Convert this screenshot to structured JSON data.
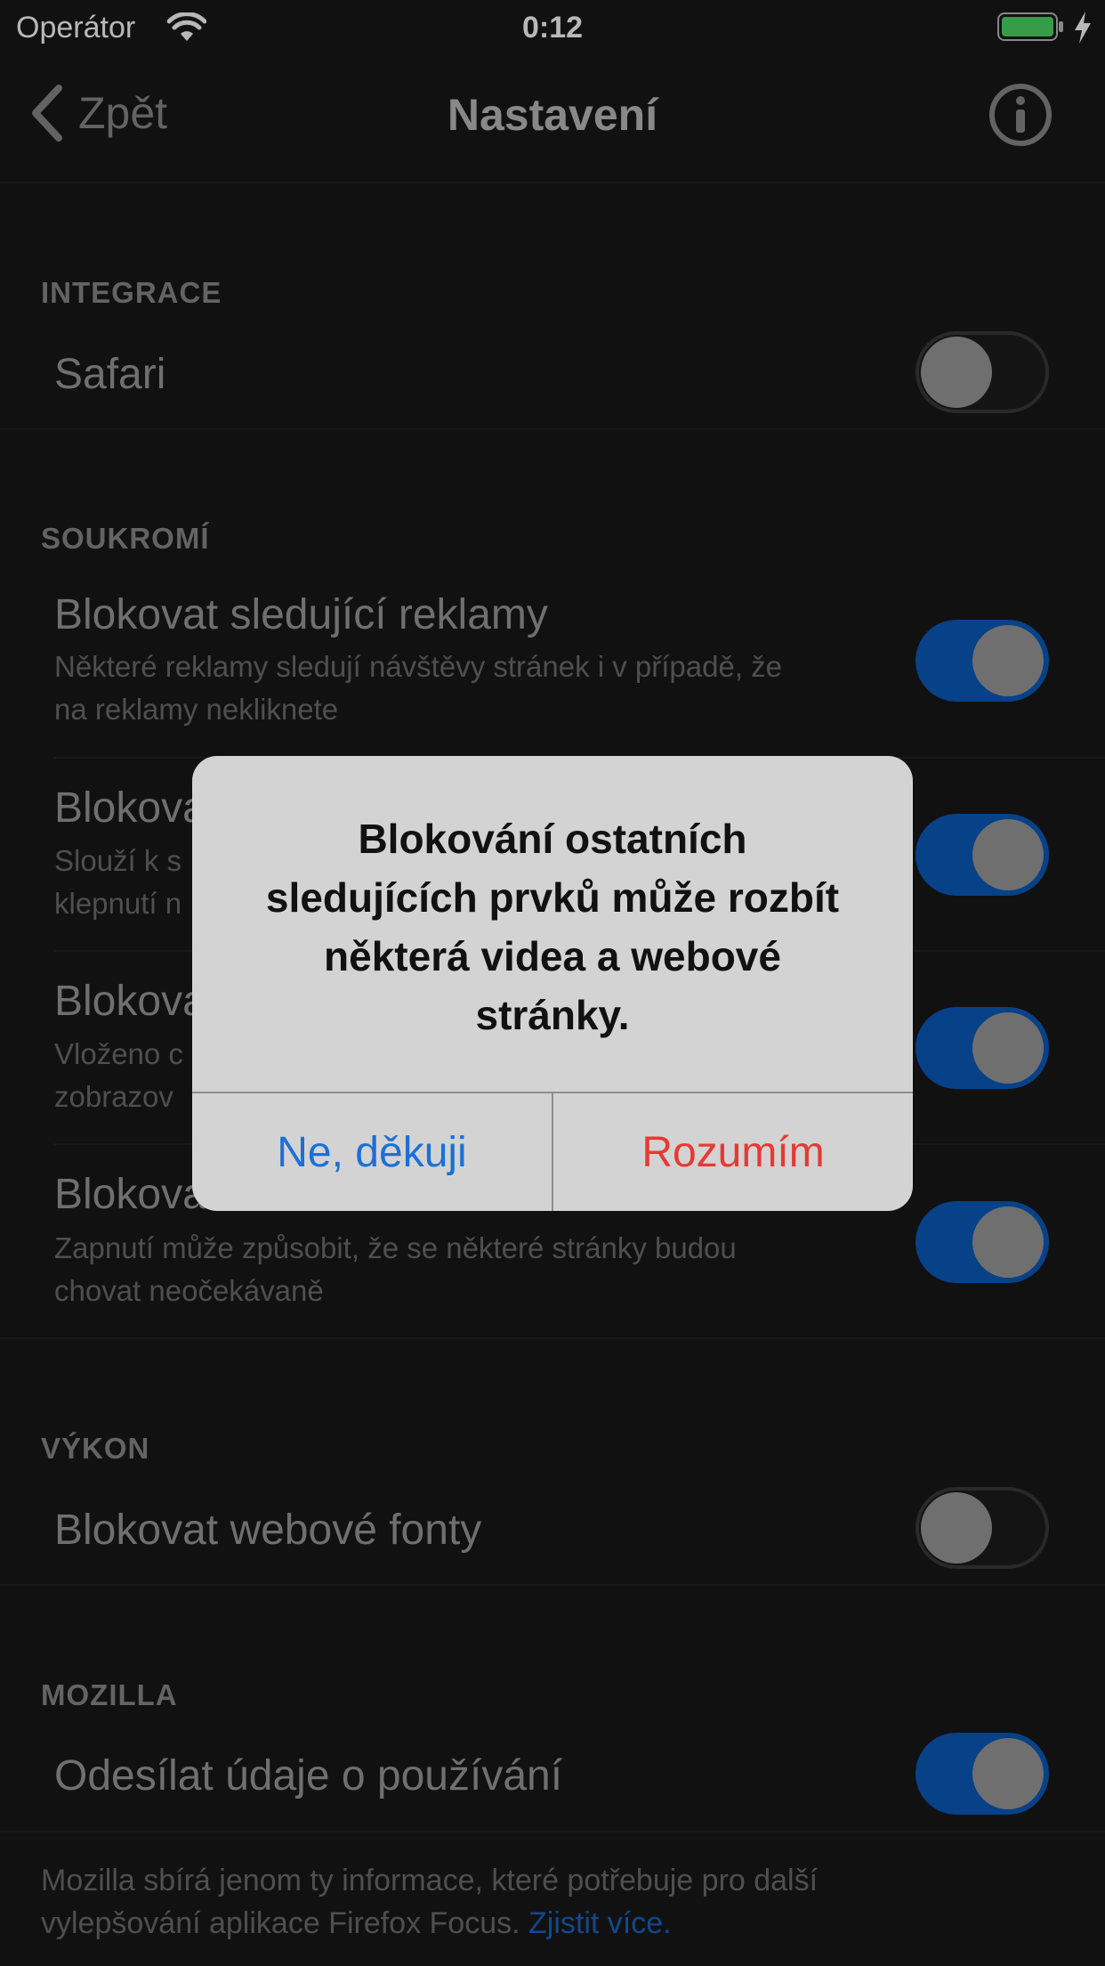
{
  "status_bar": {
    "carrier": "Operátor",
    "time": "0:12",
    "battery_color": "#4cd964"
  },
  "nav": {
    "back_label": "Zpět",
    "title": "Nastavení"
  },
  "sections": {
    "integration": {
      "header": "INTEGRACE",
      "rows": [
        {
          "title": "Safari",
          "enabled": false
        }
      ]
    },
    "privacy": {
      "header": "SOUKROMÍ",
      "rows": [
        {
          "title": "Blokovat sledující reklamy",
          "subtitle_line1": "Některé reklamy sledují návštěvy stránek i v případě, že",
          "subtitle_line2": "na reklamy nekliknete",
          "enabled": true
        },
        {
          "title": "Blokova",
          "subtitle_line1": "Slouží k s",
          "subtitle_line2": "klepnutí n",
          "enabled": true
        },
        {
          "title": "Blokova",
          "subtitle_line1": "Vloženo c",
          "subtitle_line2": "zobrazov",
          "enabled": true
        },
        {
          "title": "Blokova",
          "subtitle_line1": "Zapnutí může způsobit, že se některé stránky budou",
          "subtitle_line2": "chovat neočekávaně",
          "enabled": true
        }
      ]
    },
    "performance": {
      "header": "VÝKON",
      "rows": [
        {
          "title": "Blokovat webové fonty",
          "enabled": false
        }
      ]
    },
    "mozilla": {
      "header": "MOZILLA",
      "rows": [
        {
          "title": "Odesílat údaje o používání",
          "enabled": true
        }
      ],
      "footer_text_1": "Mozilla sbírá jenom ty informace, které potřebuje pro další",
      "footer_text_2": "vylepšování aplikace Firefox Focus. ",
      "footer_link": "Zjistit více."
    }
  },
  "alert": {
    "line1": "Blokování ostatních",
    "line2": "sledujících prvků může rozbít",
    "line3": "některá videa a webové",
    "line4": "stránky.",
    "cancel_label": "Ne, děkuji",
    "confirm_label": "Rozumím"
  },
  "colors": {
    "accent_blue": "#0a5bbd",
    "link_blue": "#1a65c2",
    "destructive_red": "#e53a34"
  }
}
